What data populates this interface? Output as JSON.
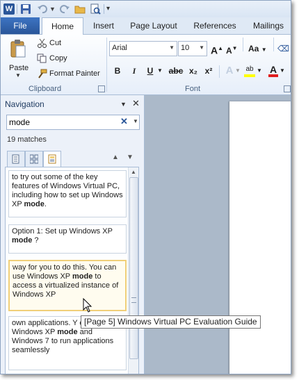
{
  "qat": {
    "word_logo": "W",
    "icons": [
      "word-icon",
      "save-icon",
      "undo-icon",
      "redo-icon",
      "open-icon",
      "print-preview-icon"
    ]
  },
  "tabs": {
    "file": "File",
    "home": "Home",
    "insert": "Insert",
    "page_layout": "Page Layout",
    "references": "References",
    "mailings": "Mailings"
  },
  "ribbon": {
    "clipboard": {
      "paste": "Paste",
      "cut": "Cut",
      "copy": "Copy",
      "format_painter": "Format Painter",
      "group_label": "Clipboard"
    },
    "font": {
      "font_name": "Arial",
      "font_size": "10",
      "grow": "A",
      "shrink": "A",
      "change_case": "Aa",
      "bold": "B",
      "italic": "I",
      "underline": "U",
      "strikethrough": "abc",
      "subscript": "x₂",
      "superscript": "x²",
      "text_effects": "A",
      "highlight": "ab",
      "font_color": "A",
      "group_label": "Font"
    }
  },
  "navigation": {
    "title": "Navigation",
    "search_value": "mode",
    "matches": "19 matches",
    "results": [
      {
        "text_before": "to try out some of the key features of Windows Virtual PC, including how to set up Windows XP ",
        "match": "mode",
        "text_after": "."
      },
      {
        "text_before": "Option 1: Set up Windows XP ",
        "match": "mode",
        "text_after": " ?"
      },
      {
        "text_before": "way for you to do this. You can use Windows XP ",
        "match": "mode",
        "text_after": " to access a virtualized instance of Windows XP"
      },
      {
        "text_before": "own applications. Y even use Windows XP ",
        "match": "mode",
        "text_after": " and Windows 7 to run applications seamlessly"
      }
    ]
  },
  "tooltip": "[Page 5]  Windows Virtual PC Evaluation Guide",
  "colors": {
    "file_tab": "#2a5699",
    "highlight_yellow": "#ffff00",
    "font_color_red": "#e01e1e",
    "selected_result_border": "#f0cf78"
  }
}
